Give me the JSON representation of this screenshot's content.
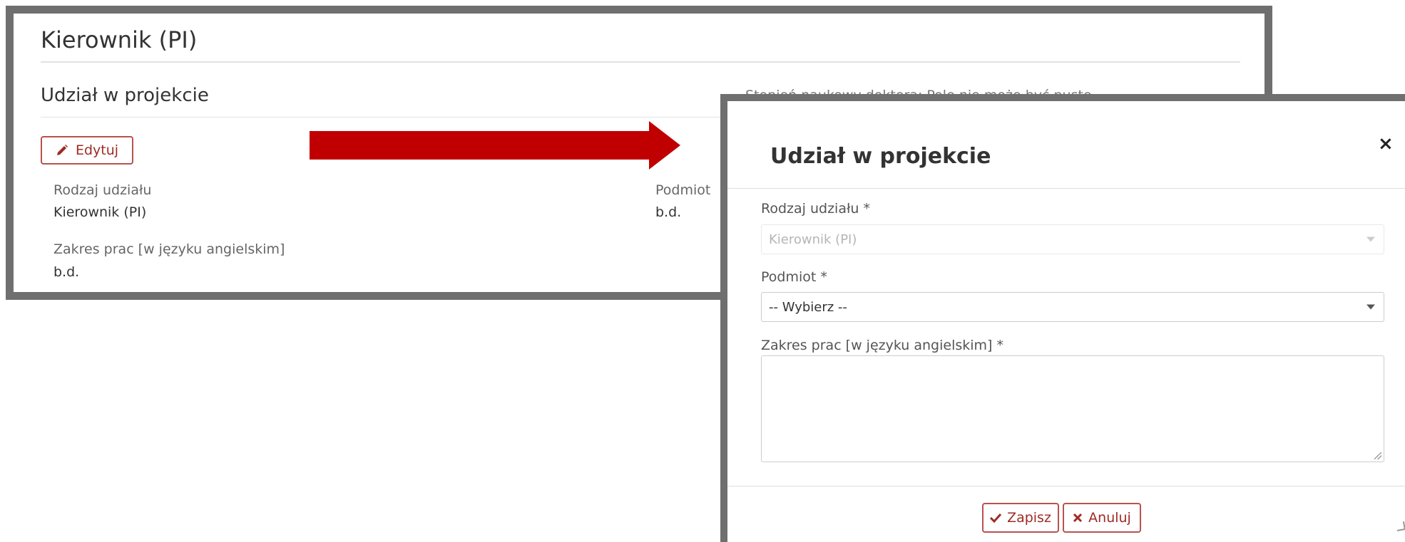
{
  "panel": {
    "title": "Kierownik (PI)",
    "section_title": "Udział w projekcie",
    "edit_button": "Edytuj",
    "fields": {
      "rodzaj_label": "Rodzaj udziału",
      "rodzaj_value": "Kierownik (PI)",
      "zakres_label": "Zakres prac [w języku angielskim]",
      "zakres_value": "b.d.",
      "podmiot_label": "Podmiot",
      "podmiot_value": "b.d."
    }
  },
  "background_text": "Stopień naukowy doktora:     Pole nie może być puste",
  "modal": {
    "title": "Udział w projekcie",
    "close": "×",
    "rodzaj_label": "Rodzaj udziału *",
    "rodzaj_value": "Kierownik (PI)",
    "podmiot_label": "Podmiot *",
    "podmiot_value": "-- Wybierz --",
    "zakres_label": "Zakres prac [w języku angielskim] *",
    "zakres_value": "",
    "save_button": "Zapisz",
    "cancel_button": "Anuluj"
  },
  "icons": {
    "edit": "pencil-icon",
    "save": "checkmark-icon",
    "cancel": "x-icon",
    "arrow": "right-arrow-icon",
    "dropdown": "caret-down-icon"
  },
  "colors": {
    "accent": "#9e2a24",
    "arrow": "#c00000",
    "frame": "#6f6f6f"
  }
}
